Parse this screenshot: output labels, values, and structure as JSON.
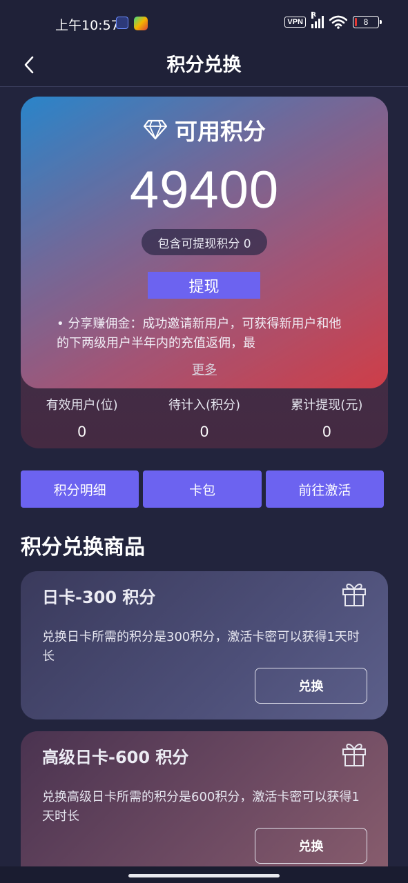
{
  "status_bar": {
    "time": "上午10:57",
    "vpn": "VPN",
    "signal_r": "R",
    "battery": "8"
  },
  "header": {
    "title": "积分兑换",
    "back_icon": "chevron-left-icon"
  },
  "points_card": {
    "icon": "diamond-icon",
    "title": "可用积分",
    "value": "49400",
    "include_text": "包含可提现积分 0",
    "withdraw_label": "提现",
    "description": "• 分享赚佣金：成功邀请新用户，可获得新用户和他的下两级用户半年内的充值返佣，最",
    "more_label": "更多",
    "gradient": [
      "#2a93de",
      "#e6424a"
    ]
  },
  "stats": [
    {
      "label": "有效用户(位)",
      "value": "0"
    },
    {
      "label": "待计入(积分)",
      "value": "0"
    },
    {
      "label": "累计提现(元)",
      "value": "0"
    }
  ],
  "actions": [
    {
      "label": "积分明细"
    },
    {
      "label": "卡包"
    },
    {
      "label": "前往激活"
    }
  ],
  "section_title": "积分兑换商品",
  "products": [
    {
      "title": "日卡-300 积分",
      "description": "兑换日卡所需的积分是300积分，激活卡密可以获得1天时长",
      "button_label": "兑换",
      "icon": "gift-icon"
    },
    {
      "title": "高级日卡-600 积分",
      "description": "兑换高级日卡所需的积分是600积分，激活卡密可以获得1天时长",
      "button_label": "兑换",
      "icon": "gift-icon"
    }
  ],
  "colors": {
    "accent": "#6c63f0",
    "background": "#22243d"
  }
}
